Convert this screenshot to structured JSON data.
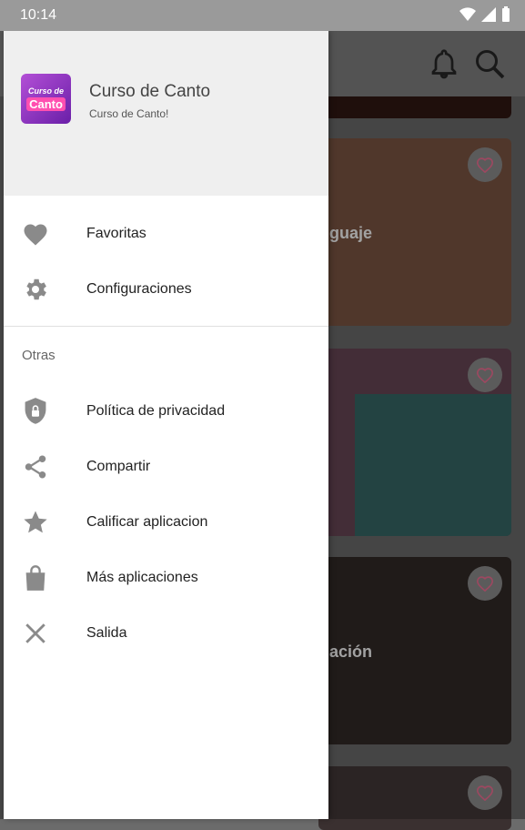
{
  "status_bar": {
    "time": "10:14"
  },
  "drawer": {
    "app_name": "Curso de Canto",
    "app_subtitle": "Curso de Canto!",
    "logo_text_top": "Curso de",
    "logo_text_bottom": "Canto",
    "primary_items": [
      {
        "label": "Favoritas",
        "icon": "heart-icon"
      },
      {
        "label": "Configuraciones",
        "icon": "gear-icon"
      }
    ],
    "section_title": "Otras",
    "secondary_items": [
      {
        "label": "Política de privacidad",
        "icon": "shield-lock-icon"
      },
      {
        "label": "Compartir",
        "icon": "share-icon"
      },
      {
        "label": "Calificar aplicacion",
        "icon": "star-icon"
      },
      {
        "label": "Más aplicaciones",
        "icon": "shopping-bag-icon"
      },
      {
        "label": "Salida",
        "icon": "close-icon"
      }
    ]
  },
  "background_cards": [
    {
      "title_fragment": "guaje"
    },
    {
      "title_fragment": ""
    },
    {
      "title_fragment": "ación"
    },
    {
      "title_fragment": ""
    }
  ],
  "colors": {
    "drawer_header_bg": "#efefef",
    "icon_gray": "#8a8a8a",
    "scrim": "#5d5d5d"
  }
}
